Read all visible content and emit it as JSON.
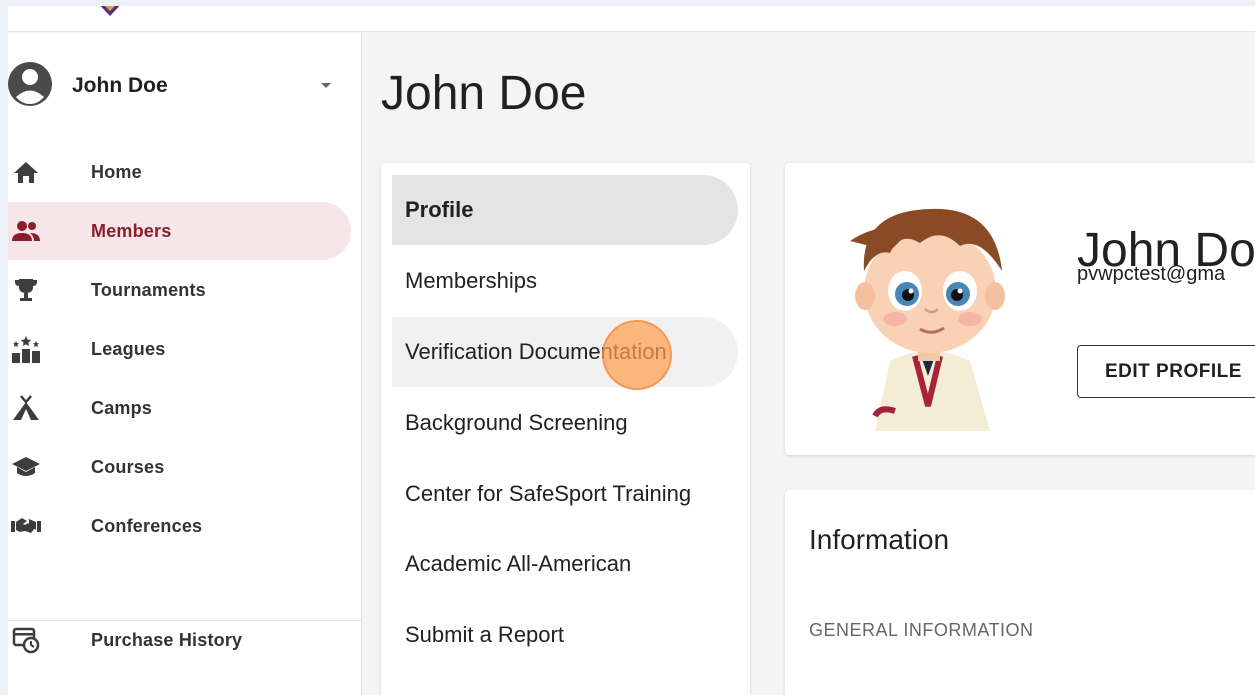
{
  "colors": {
    "accent": "#8c1d2c",
    "active_bg": "#f6e6ea",
    "click_marker": "#ffa050"
  },
  "user": {
    "name": "John Doe",
    "avatar_icon": "account-circle-icon",
    "menu_icon": "caret-down-icon"
  },
  "sidebar": {
    "items": [
      {
        "label": "Home",
        "icon": "home-icon",
        "active": false
      },
      {
        "label": "Members",
        "icon": "people-icon",
        "active": true
      },
      {
        "label": "Tournaments",
        "icon": "trophy-icon",
        "active": false
      },
      {
        "label": "Leagues",
        "icon": "podium-icon",
        "active": false
      },
      {
        "label": "Camps",
        "icon": "tent-icon",
        "active": false
      },
      {
        "label": "Courses",
        "icon": "graduation-cap-icon",
        "active": false
      },
      {
        "label": "Conferences",
        "icon": "handshake-icon",
        "active": false
      }
    ],
    "secondary_items": [
      {
        "label": "Purchase History",
        "icon": "receipt-clock-icon"
      }
    ]
  },
  "page": {
    "title": "John Doe"
  },
  "profile_menu": {
    "items": [
      {
        "label": "Profile",
        "state": "active"
      },
      {
        "label": "Memberships",
        "state": "normal"
      },
      {
        "label": "Verification Documentation",
        "state": "hover"
      },
      {
        "label": "Background Screening",
        "state": "normal"
      },
      {
        "label": "Center for SafeSport Training",
        "state": "normal"
      },
      {
        "label": "Academic All-American",
        "state": "normal"
      },
      {
        "label": "Submit a Report",
        "state": "normal"
      }
    ]
  },
  "profile_card": {
    "name": "John Do",
    "email": "pvwpctest@gma",
    "edit_button": "EDIT PROFILE"
  },
  "info_card": {
    "title": "Information",
    "section_label": "GENERAL INFORMATION"
  }
}
